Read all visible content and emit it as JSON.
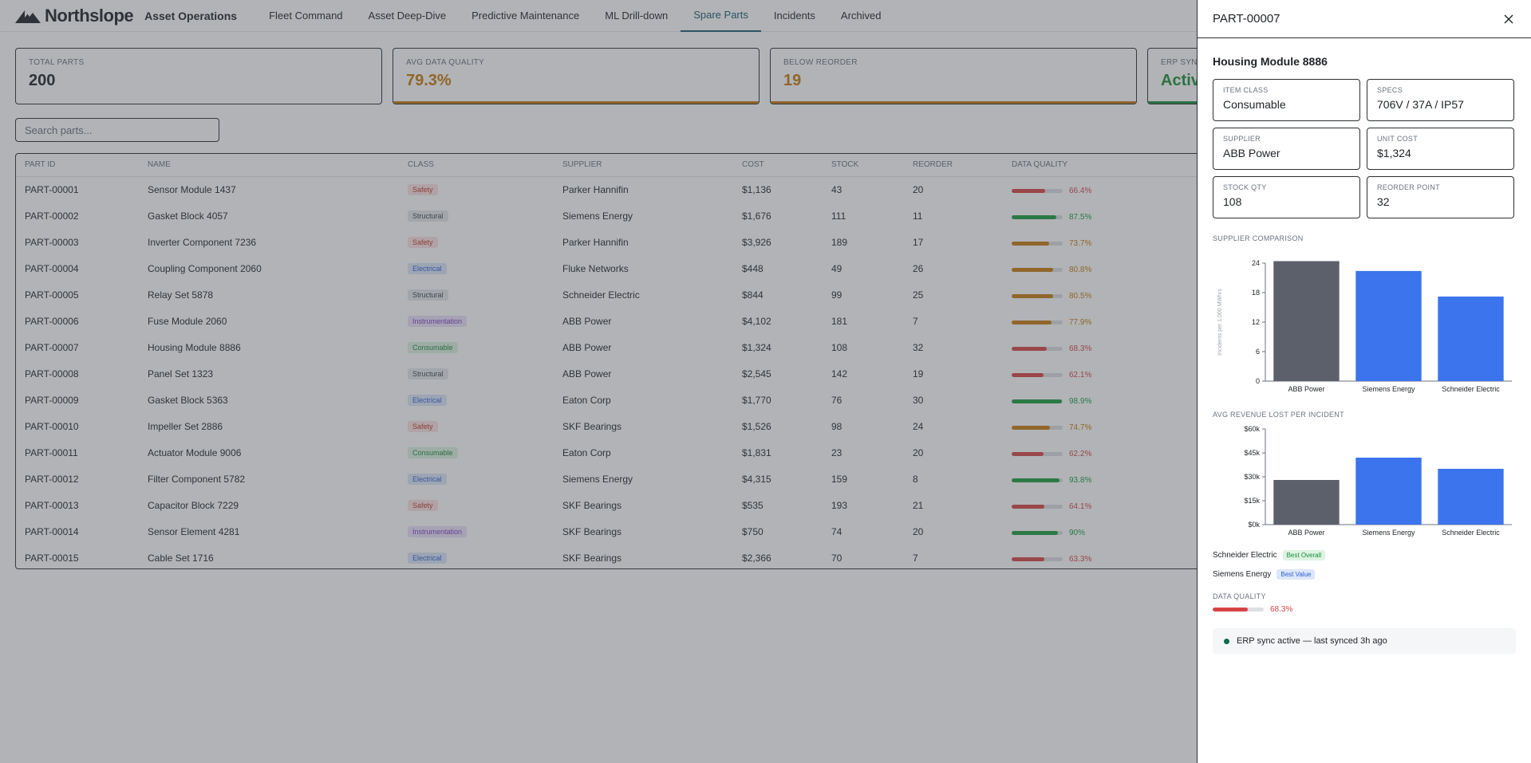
{
  "brand": {
    "name": "Northslope",
    "subtitle": "Asset Operations"
  },
  "nav": [
    {
      "label": "Fleet Command",
      "active": false
    },
    {
      "label": "Asset Deep-Dive",
      "active": false
    },
    {
      "label": "Predictive Maintenance",
      "active": false
    },
    {
      "label": "ML Drill-down",
      "active": false
    },
    {
      "label": "Spare Parts",
      "active": true
    },
    {
      "label": "Incidents",
      "active": false
    },
    {
      "label": "Archived",
      "active": false
    }
  ],
  "kpis": [
    {
      "label": "Total Parts",
      "value": "200",
      "color": "#1f2328",
      "bar": ""
    },
    {
      "label": "Avg Data Quality",
      "value": "79.3%",
      "color": "#c77a0e",
      "bar": "#c77a0e"
    },
    {
      "label": "Below Reorder",
      "value": "19",
      "color": "#c77a0e",
      "bar": "#c77a0e"
    },
    {
      "label": "ERP Sync",
      "value": "Active",
      "color": "#1a8f3a",
      "bar": "#1a8f3a"
    }
  ],
  "search": {
    "placeholder": "Search parts..."
  },
  "table": {
    "headers": [
      "Part ID",
      "Name",
      "Class",
      "Supplier",
      "Cost",
      "Stock",
      "Reorder",
      "Data Quality"
    ],
    "rows": [
      {
        "id": "PART-00001",
        "name": "Sensor Module 1437",
        "cls": "Safety",
        "supplier": "Parker Hannifin",
        "cost": "$1,136",
        "stock": "43",
        "reorder": "20",
        "dq": 66.4,
        "dq_label": "66.4%"
      },
      {
        "id": "PART-00002",
        "name": "Gasket Block 4057",
        "cls": "Structural",
        "supplier": "Siemens Energy",
        "cost": "$1,676",
        "stock": "111",
        "reorder": "11",
        "dq": 87.5,
        "dq_label": "87.5%"
      },
      {
        "id": "PART-00003",
        "name": "Inverter Component 7236",
        "cls": "Safety",
        "supplier": "Parker Hannifin",
        "cost": "$3,926",
        "stock": "189",
        "reorder": "17",
        "dq": 73.7,
        "dq_label": "73.7%"
      },
      {
        "id": "PART-00004",
        "name": "Coupling Component 2060",
        "cls": "Electrical",
        "supplier": "Fluke Networks",
        "cost": "$448",
        "stock": "49",
        "reorder": "26",
        "dq": 80.8,
        "dq_label": "80.8%"
      },
      {
        "id": "PART-00005",
        "name": "Relay Set 5878",
        "cls": "Structural",
        "supplier": "Schneider Electric",
        "cost": "$844",
        "stock": "99",
        "reorder": "25",
        "dq": 80.5,
        "dq_label": "80.5%"
      },
      {
        "id": "PART-00006",
        "name": "Fuse Module 2060",
        "cls": "Instrumentation",
        "supplier": "ABB Power",
        "cost": "$4,102",
        "stock": "181",
        "reorder": "7",
        "dq": 77.9,
        "dq_label": "77.9%"
      },
      {
        "id": "PART-00007",
        "name": "Housing Module 8886",
        "cls": "Consumable",
        "supplier": "ABB Power",
        "cost": "$1,324",
        "stock": "108",
        "reorder": "32",
        "dq": 68.3,
        "dq_label": "68.3%"
      },
      {
        "id": "PART-00008",
        "name": "Panel Set 1323",
        "cls": "Structural",
        "supplier": "ABB Power",
        "cost": "$2,545",
        "stock": "142",
        "reorder": "19",
        "dq": 62.1,
        "dq_label": "62.1%"
      },
      {
        "id": "PART-00009",
        "name": "Gasket Block 5363",
        "cls": "Electrical",
        "supplier": "Eaton Corp",
        "cost": "$1,770",
        "stock": "76",
        "reorder": "30",
        "dq": 98.9,
        "dq_label": "98.9%"
      },
      {
        "id": "PART-00010",
        "name": "Impeller Set 2886",
        "cls": "Safety",
        "supplier": "SKF Bearings",
        "cost": "$1,526",
        "stock": "98",
        "reorder": "24",
        "dq": 74.7,
        "dq_label": "74.7%"
      },
      {
        "id": "PART-00011",
        "name": "Actuator Module 9006",
        "cls": "Consumable",
        "supplier": "Eaton Corp",
        "cost": "$1,831",
        "stock": "23",
        "reorder": "20",
        "dq": 62.2,
        "dq_label": "62.2%"
      },
      {
        "id": "PART-00012",
        "name": "Filter Component 5782",
        "cls": "Electrical",
        "supplier": "Siemens Energy",
        "cost": "$4,315",
        "stock": "159",
        "reorder": "8",
        "dq": 93.8,
        "dq_label": "93.8%"
      },
      {
        "id": "PART-00013",
        "name": "Capacitor Block 7229",
        "cls": "Safety",
        "supplier": "SKF Bearings",
        "cost": "$535",
        "stock": "193",
        "reorder": "21",
        "dq": 64.1,
        "dq_label": "64.1%"
      },
      {
        "id": "PART-00014",
        "name": "Sensor Element 4281",
        "cls": "Instrumentation",
        "supplier": "SKF Bearings",
        "cost": "$750",
        "stock": "74",
        "reorder": "20",
        "dq": 90,
        "dq_label": "90%"
      },
      {
        "id": "PART-00015",
        "name": "Cable Set 1716",
        "cls": "Electrical",
        "supplier": "SKF Bearings",
        "cost": "$2,366",
        "stock": "70",
        "reorder": "7",
        "dq": 63.3,
        "dq_label": "63.3%"
      }
    ]
  },
  "class_colors": {
    "Safety": {
      "bg": "#fde2e2",
      "fg": "#c0392b"
    },
    "Structural": {
      "bg": "#e6e8eb",
      "fg": "#3f4650"
    },
    "Electrical": {
      "bg": "#dde7fb",
      "fg": "#2f5fd0"
    },
    "Instrumentation": {
      "bg": "#eee0fb",
      "fg": "#7b3fc4"
    },
    "Consumable": {
      "bg": "#ddf4e2",
      "fg": "#1f8a3b"
    }
  },
  "dq_colors": {
    "low": "#d64545",
    "mid": "#c77a0e",
    "high": "#1a9b3f"
  },
  "drawer": {
    "title": "PART-00007",
    "part_name": "Housing Module 8886",
    "fields": [
      {
        "label": "Item Class",
        "value": "Consumable"
      },
      {
        "label": "Specs",
        "value": "706V / 37A / IP57"
      },
      {
        "label": "Supplier",
        "value": "ABB Power"
      },
      {
        "label": "Unit Cost",
        "value": "$1,324"
      },
      {
        "label": "Stock Qty",
        "value": "108"
      },
      {
        "label": "Reorder Point",
        "value": "32"
      }
    ],
    "supplier_comparison_label": "Supplier Comparison",
    "revenue_label": "Avg Revenue Lost Per Incident",
    "legend": [
      {
        "supplier": "Schneider Electric",
        "badge": "Best Overall",
        "bg": "#ddf4e2",
        "fg": "#1f8a3b"
      },
      {
        "supplier": "Siemens Energy",
        "badge": "Best Value",
        "bg": "#dde7fb",
        "fg": "#2f5fd0"
      }
    ],
    "data_quality_label": "Data Quality",
    "data_quality_value": 68.3,
    "data_quality_text": "68.3%",
    "sync_text": "ERP sync active — last synced 3h ago"
  },
  "chart_data": [
    {
      "type": "bar",
      "categories": [
        "ABB Power",
        "Siemens Energy",
        "Schneider Electric"
      ],
      "values": [
        24.4,
        22.4,
        17.2
      ],
      "ylabel": "Incidents per 1,000 MWhrs",
      "ylim": [
        0,
        24
      ],
      "yticks": [
        0,
        6,
        12,
        18,
        24
      ],
      "ytick_labels": [
        "0",
        "6",
        "12",
        "18",
        "24"
      ],
      "bar_colors": [
        "#5b606b",
        "#3b74ec",
        "#3b74ec"
      ],
      "grid": false
    },
    {
      "type": "bar",
      "categories": [
        "ABB Power",
        "Siemens Energy",
        "Schneider Electric"
      ],
      "values": [
        28000,
        42000,
        35000
      ],
      "ylim": [
        0,
        60000
      ],
      "yticks": [
        0,
        15000,
        30000,
        45000,
        60000
      ],
      "ytick_labels": [
        "$0k",
        "$15k",
        "$30k",
        "$45k",
        "$60k"
      ],
      "bar_colors": [
        "#5b606b",
        "#3b74ec",
        "#3b74ec"
      ],
      "grid": false
    }
  ]
}
